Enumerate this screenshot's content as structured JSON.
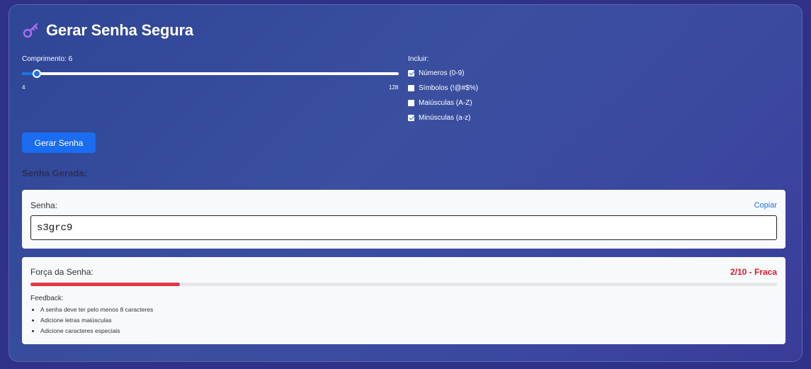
{
  "header": {
    "title": "Gerar Senha Segura",
    "icon": "key-icon"
  },
  "length": {
    "label": "Comprimento: 6",
    "value": 6,
    "min": 4,
    "max": 128,
    "min_label": "4",
    "max_label": "128"
  },
  "include": {
    "label": "Incluir:",
    "options": [
      {
        "label": "Números (0-9)",
        "checked": true
      },
      {
        "label": "Símbolos (!@#$%)",
        "checked": false
      },
      {
        "label": "Maiúsculas (A-Z)",
        "checked": false
      },
      {
        "label": "Minúsculas (a-z)",
        "checked": true
      }
    ]
  },
  "generate_button": "Gerar Senha",
  "result": {
    "heading": "Senha Gerada:",
    "password_label": "Senha:",
    "copy_label": "Copiar",
    "password": "s3grc9"
  },
  "strength": {
    "label": "Força da Senha:",
    "score_text": "2/10 - Fraca",
    "fraction": 0.2,
    "bar_color": "#e03a45",
    "feedback_label": "Feedback:",
    "feedback": [
      "A senha deve ter pelo menos 8 caracteres",
      "Adicione letras maiúsculas",
      "Adicione caracteres especiais"
    ]
  },
  "colors": {
    "accent": "#1a6cf0",
    "danger": "#d91c2a"
  }
}
